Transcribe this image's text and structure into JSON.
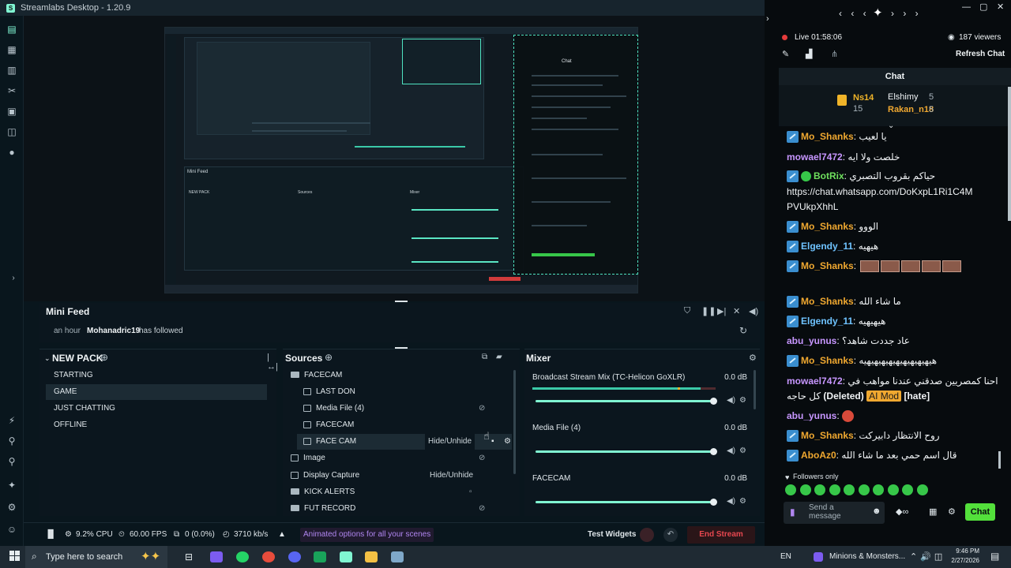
{
  "window": {
    "title": "Streamlabs Desktop - 1.20.9"
  },
  "mini_feed": {
    "title": "Mini Feed",
    "time": "an hour",
    "user": "Mohanadric19",
    "action": "has followed"
  },
  "scenes": {
    "title": "NEW PACK",
    "items": [
      "STARTING",
      "GAME",
      "JUST CHATTING",
      "OFFLINE"
    ],
    "selected": 1
  },
  "sources": {
    "title": "Sources",
    "rows": [
      {
        "name": "FACECAM",
        "kind": "folder",
        "indent": 0
      },
      {
        "name": "LAST DON",
        "kind": "file",
        "indent": 1
      },
      {
        "name": "Media File (4)",
        "kind": "file",
        "indent": 1
      },
      {
        "name": "FACECAM",
        "kind": "file",
        "indent": 1
      },
      {
        "name": "FACE CAM",
        "kind": "file",
        "indent": 1
      },
      {
        "name": "Image",
        "kind": "image",
        "indent": 0
      },
      {
        "name": "Display Capture",
        "kind": "monitor",
        "indent": 0
      },
      {
        "name": "KICK ALERTS",
        "kind": "folder",
        "indent": 0
      },
      {
        "name": "FUT RECORD",
        "kind": "folder",
        "indent": 0
      }
    ],
    "tooltip": "Hide/Unhide",
    "tooltip2": "Hide/Unhide"
  },
  "mixer": {
    "title": "Mixer",
    "tracks": [
      {
        "name": "Broadcast Stream Mix (TC-Helicon GoXLR)",
        "db": "0.0 dB",
        "level": 1.0
      },
      {
        "name": "Media File (4)",
        "db": "0.0 dB",
        "level": 1.0
      },
      {
        "name": "FACECAM",
        "db": "0.0 dB",
        "level": 1.0
      }
    ]
  },
  "status": {
    "cpu": "9.2% CPU",
    "fps": "60.00 FPS",
    "dropped": "0 (0.0%)",
    "bitrate": "3710 kb/s",
    "promo": "Animated options for all your scenes",
    "test_widgets": "Test Widgets",
    "end_stream": "End Stream"
  },
  "chat": {
    "live": "Live 01:58:06",
    "viewers": "187 viewers",
    "refresh": "Refresh Chat",
    "title": "Chat",
    "leaderboard": {
      "first": "Ns14",
      "first_val": "15",
      "second": "Elshimy",
      "second_val": "5",
      "third": "Rakan_n18",
      "third_val": "5"
    },
    "messages": [
      {
        "user": "Mo_Shanks",
        "color": "y",
        "text": "يا لعيب",
        "badge": true
      },
      {
        "user": "mowael7472",
        "color": "p",
        "text": "خلصت ولا ايه",
        "badge": false
      },
      {
        "user": "BotRix",
        "color": "g",
        "text": "حياكم بقروب التصبري",
        "badge": true
      },
      {
        "user": "",
        "color": "y",
        "text": "https://chat.whatsapp.com/DoKxpL1Ri1C4M",
        "badge": false
      },
      {
        "user": "",
        "color": "y",
        "text": "PVUkpXhhL",
        "badge": false
      },
      {
        "user": "Mo_Shanks",
        "color": "y",
        "text": "الووو",
        "badge": true
      },
      {
        "user": "Elgendy_11",
        "color": "b",
        "text": "هيهيه",
        "badge": true
      },
      {
        "user": "Mo_Shanks",
        "color": "y",
        "text": "",
        "badge": true
      },
      {
        "user": "Mo_Shanks",
        "color": "y",
        "text": "ما شاء الله",
        "badge": true
      },
      {
        "user": "Elgendy_11",
        "color": "b",
        "text": "هيهيهيه",
        "badge": true
      },
      {
        "user": "abu_yunus",
        "color": "p",
        "text": "عاد جددت شاهد؟",
        "badge": false
      },
      {
        "user": "Mo_Shanks",
        "color": "y",
        "text": "هيهيهيهيهيهيهيهيهيهيه",
        "badge": true
      },
      {
        "user": "mowael7472",
        "color": "p",
        "text": "احنا كمصريين صدقني عندنا مواهب في",
        "badge": false
      },
      {
        "user": "",
        "color": "y",
        "text": "كل حاجه",
        "badge": false
      },
      {
        "user": "abu_yunus",
        "color": "p",
        "text": "",
        "badge": false
      },
      {
        "user": "Mo_Shanks",
        "color": "y",
        "text": "روح الانتظار دابيركت",
        "badge": true
      },
      {
        "user": "AboAz0",
        "color": "y",
        "text": "قال اسم حمي بعد ما شاء الله",
        "badge": true
      }
    ],
    "deleted": "(Deleted)",
    "mod_tag": "AI Mod",
    "hate": "[hate]",
    "followers_only": "Followers only",
    "input_placeholder": "Send a message",
    "send": "Chat"
  },
  "taskbar": {
    "search": "Type here to search",
    "lang": "EN",
    "app": "Minions & Monsters...",
    "time": "9:46 PM",
    "date": "2/27/2026"
  }
}
